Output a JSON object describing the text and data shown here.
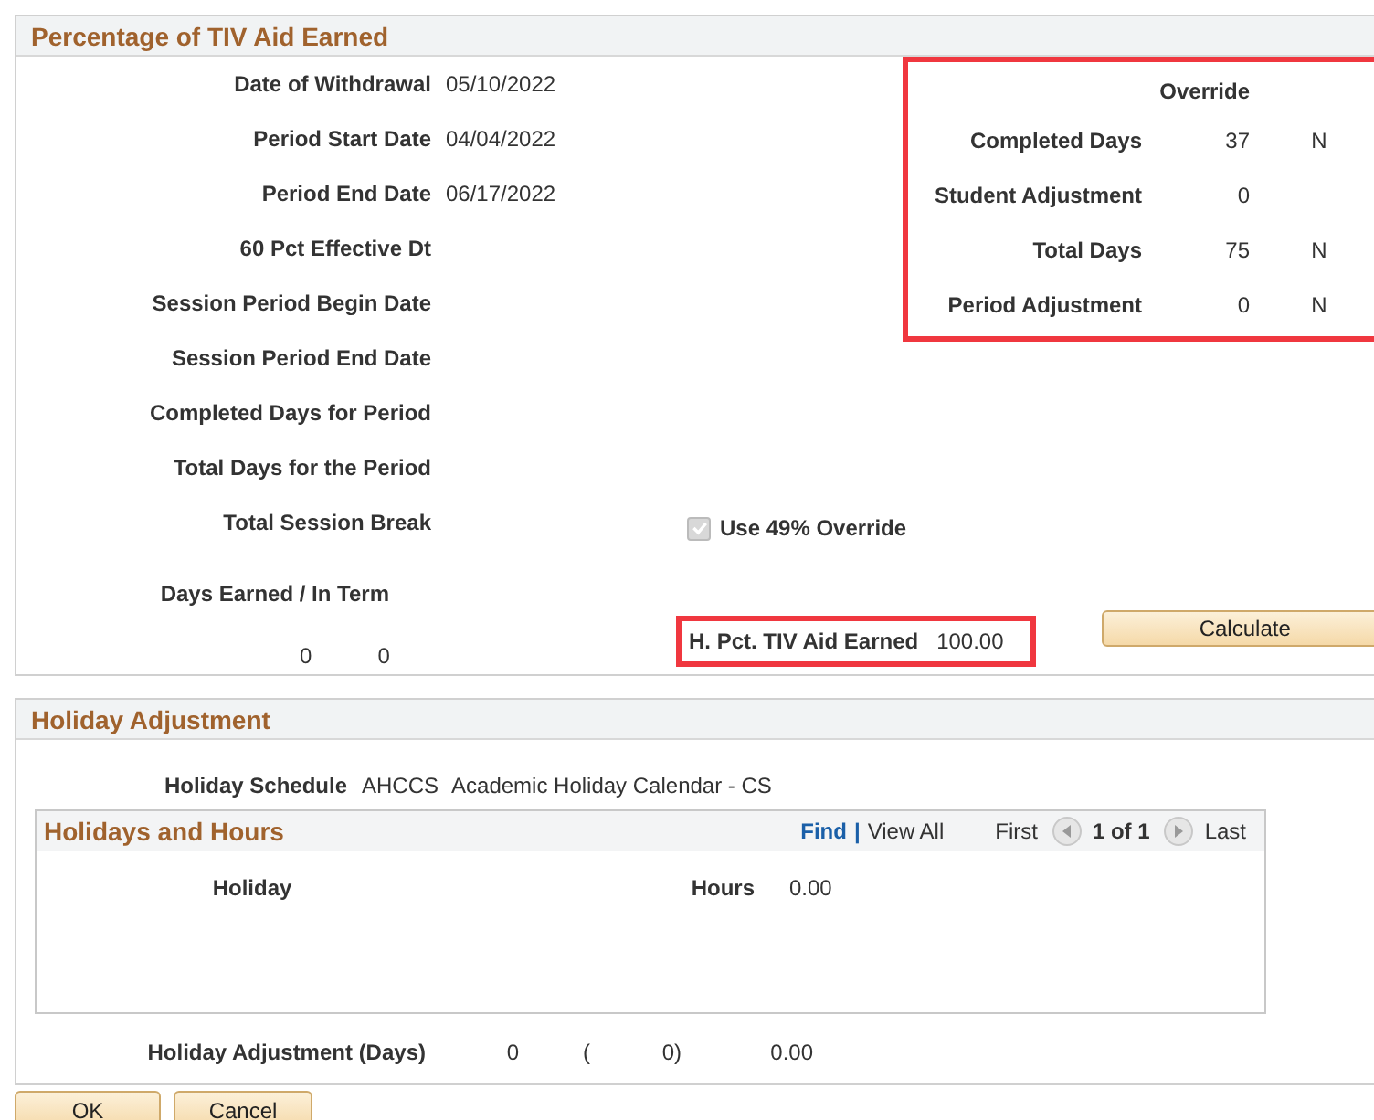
{
  "tiv_section": {
    "title": "Percentage of TIV Aid Earned",
    "fields": [
      {
        "label": "Date of Withdrawal",
        "value": "05/10/2022"
      },
      {
        "label": "Period Start Date",
        "value": "04/04/2022"
      },
      {
        "label": "Period End Date",
        "value": "06/17/2022"
      },
      {
        "label": "60 Pct Effective Dt"
      },
      {
        "label": "Session Period Begin Date"
      },
      {
        "label": "Session Period End Date"
      },
      {
        "label": "Completed Days for Period"
      },
      {
        "label": "Total Days for the Period"
      },
      {
        "label": "Total Session Break"
      }
    ],
    "days_earned": {
      "label": "Days Earned / In Term",
      "values": [
        "0",
        "0"
      ]
    },
    "override": {
      "title": "Override",
      "highlighted": true,
      "rows": [
        {
          "label": "Completed Days",
          "value": "37",
          "flag": "N"
        },
        {
          "label": "Student Adjustment",
          "value": "0"
        },
        {
          "label": "Total Days",
          "value": "75",
          "flag": "N"
        },
        {
          "label": "Period Adjustment",
          "value": "0",
          "flag": "N"
        }
      ]
    },
    "use_49_override": {
      "label": "Use 49% Override",
      "checked": true,
      "disabled": true
    },
    "pct_earned": {
      "label": "H. Pct. TIV Aid Earned",
      "value": "100.00",
      "highlighted": true
    },
    "calculate_button": "Calculate"
  },
  "holiday_section": {
    "title": "Holiday Adjustment",
    "schedule": {
      "label": "Holiday Schedule",
      "code": "AHCCS",
      "description": "Academic Holiday Calendar - CS"
    },
    "grid": {
      "title": "Holidays and Hours",
      "find": "Find",
      "separator": "|",
      "view_all": "View All",
      "first": "First",
      "range": "1 of 1",
      "last": "Last",
      "holiday_label": "Holiday",
      "hours_label": "Hours",
      "hours_value": "0.00"
    },
    "adjustment": {
      "label": "Holiday Adjustment (Days)",
      "values": [
        "0",
        "(",
        "0)",
        "0.00"
      ]
    }
  },
  "buttons": [
    "OK",
    "Cancel"
  ]
}
